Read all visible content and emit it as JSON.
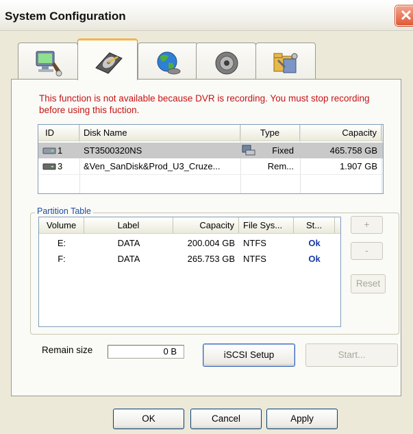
{
  "window": {
    "title": "System Configuration",
    "close_glyph": "✕"
  },
  "tabs": [
    {
      "icon": "display-settings-icon"
    },
    {
      "icon": "hard-disk-icon",
      "active": true
    },
    {
      "icon": "network-globe-icon"
    },
    {
      "icon": "speaker-icon"
    },
    {
      "icon": "tools-settings-icon"
    }
  ],
  "warning_text": "This function is not available because DVR is recording. You must stop recording before using this fuction.",
  "disk_list": {
    "columns": [
      "ID",
      "Disk Name",
      "Type",
      "Capacity"
    ],
    "rows": [
      {
        "id": "1",
        "name": "ST3500320NS",
        "type": "Fixed",
        "capacity": "465.758 GB",
        "selected": true
      },
      {
        "id": "3",
        "name": "&Ven_SanDisk&Prod_U3_Cruze...",
        "type": "Rem...",
        "capacity": "1.907 GB",
        "selected": false
      }
    ]
  },
  "partition_table": {
    "title": "Partition Table",
    "columns": [
      "Volume",
      "Label",
      "Capacity",
      "File Sys...",
      "St..."
    ],
    "rows": [
      {
        "volume": "E:",
        "label": "DATA",
        "capacity": "200.004 GB",
        "fs": "NTFS",
        "status": "Ok"
      },
      {
        "volume": "F:",
        "label": "DATA",
        "capacity": "265.753 GB",
        "fs": "NTFS",
        "status": "Ok"
      }
    ],
    "buttons": {
      "add": "+",
      "remove": "-",
      "reset": "Reset"
    }
  },
  "remain": {
    "label": "Remain size",
    "value": "0 B"
  },
  "buttons": {
    "iscsi": "iSCSI Setup",
    "start": "Start...",
    "ok": "OK",
    "cancel": "Cancel",
    "apply": "Apply"
  },
  "colors": {
    "warning": "#c51414",
    "status_ok": "#1939a8",
    "active_tab_accent": "#f6b545",
    "group_label": "#1f4ea0"
  }
}
